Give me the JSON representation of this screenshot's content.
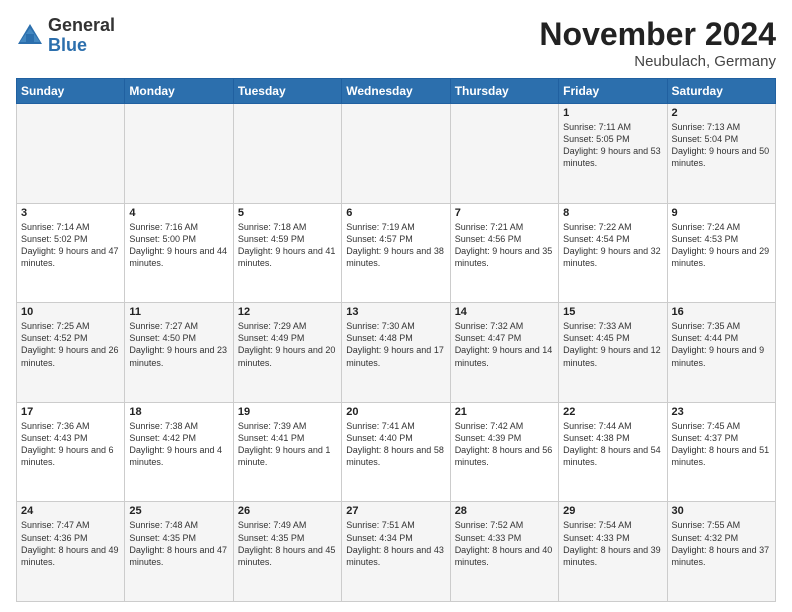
{
  "header": {
    "logo_general": "General",
    "logo_blue": "Blue",
    "month_title": "November 2024",
    "location": "Neubulach, Germany"
  },
  "days_of_week": [
    "Sunday",
    "Monday",
    "Tuesday",
    "Wednesday",
    "Thursday",
    "Friday",
    "Saturday"
  ],
  "weeks": [
    [
      {
        "day": "",
        "info": ""
      },
      {
        "day": "",
        "info": ""
      },
      {
        "day": "",
        "info": ""
      },
      {
        "day": "",
        "info": ""
      },
      {
        "day": "",
        "info": ""
      },
      {
        "day": "1",
        "info": "Sunrise: 7:11 AM\nSunset: 5:05 PM\nDaylight: 9 hours and 53 minutes."
      },
      {
        "day": "2",
        "info": "Sunrise: 7:13 AM\nSunset: 5:04 PM\nDaylight: 9 hours and 50 minutes."
      }
    ],
    [
      {
        "day": "3",
        "info": "Sunrise: 7:14 AM\nSunset: 5:02 PM\nDaylight: 9 hours and 47 minutes."
      },
      {
        "day": "4",
        "info": "Sunrise: 7:16 AM\nSunset: 5:00 PM\nDaylight: 9 hours and 44 minutes."
      },
      {
        "day": "5",
        "info": "Sunrise: 7:18 AM\nSunset: 4:59 PM\nDaylight: 9 hours and 41 minutes."
      },
      {
        "day": "6",
        "info": "Sunrise: 7:19 AM\nSunset: 4:57 PM\nDaylight: 9 hours and 38 minutes."
      },
      {
        "day": "7",
        "info": "Sunrise: 7:21 AM\nSunset: 4:56 PM\nDaylight: 9 hours and 35 minutes."
      },
      {
        "day": "8",
        "info": "Sunrise: 7:22 AM\nSunset: 4:54 PM\nDaylight: 9 hours and 32 minutes."
      },
      {
        "day": "9",
        "info": "Sunrise: 7:24 AM\nSunset: 4:53 PM\nDaylight: 9 hours and 29 minutes."
      }
    ],
    [
      {
        "day": "10",
        "info": "Sunrise: 7:25 AM\nSunset: 4:52 PM\nDaylight: 9 hours and 26 minutes."
      },
      {
        "day": "11",
        "info": "Sunrise: 7:27 AM\nSunset: 4:50 PM\nDaylight: 9 hours and 23 minutes."
      },
      {
        "day": "12",
        "info": "Sunrise: 7:29 AM\nSunset: 4:49 PM\nDaylight: 9 hours and 20 minutes."
      },
      {
        "day": "13",
        "info": "Sunrise: 7:30 AM\nSunset: 4:48 PM\nDaylight: 9 hours and 17 minutes."
      },
      {
        "day": "14",
        "info": "Sunrise: 7:32 AM\nSunset: 4:47 PM\nDaylight: 9 hours and 14 minutes."
      },
      {
        "day": "15",
        "info": "Sunrise: 7:33 AM\nSunset: 4:45 PM\nDaylight: 9 hours and 12 minutes."
      },
      {
        "day": "16",
        "info": "Sunrise: 7:35 AM\nSunset: 4:44 PM\nDaylight: 9 hours and 9 minutes."
      }
    ],
    [
      {
        "day": "17",
        "info": "Sunrise: 7:36 AM\nSunset: 4:43 PM\nDaylight: 9 hours and 6 minutes."
      },
      {
        "day": "18",
        "info": "Sunrise: 7:38 AM\nSunset: 4:42 PM\nDaylight: 9 hours and 4 minutes."
      },
      {
        "day": "19",
        "info": "Sunrise: 7:39 AM\nSunset: 4:41 PM\nDaylight: 9 hours and 1 minute."
      },
      {
        "day": "20",
        "info": "Sunrise: 7:41 AM\nSunset: 4:40 PM\nDaylight: 8 hours and 58 minutes."
      },
      {
        "day": "21",
        "info": "Sunrise: 7:42 AM\nSunset: 4:39 PM\nDaylight: 8 hours and 56 minutes."
      },
      {
        "day": "22",
        "info": "Sunrise: 7:44 AM\nSunset: 4:38 PM\nDaylight: 8 hours and 54 minutes."
      },
      {
        "day": "23",
        "info": "Sunrise: 7:45 AM\nSunset: 4:37 PM\nDaylight: 8 hours and 51 minutes."
      }
    ],
    [
      {
        "day": "24",
        "info": "Sunrise: 7:47 AM\nSunset: 4:36 PM\nDaylight: 8 hours and 49 minutes."
      },
      {
        "day": "25",
        "info": "Sunrise: 7:48 AM\nSunset: 4:35 PM\nDaylight: 8 hours and 47 minutes."
      },
      {
        "day": "26",
        "info": "Sunrise: 7:49 AM\nSunset: 4:35 PM\nDaylight: 8 hours and 45 minutes."
      },
      {
        "day": "27",
        "info": "Sunrise: 7:51 AM\nSunset: 4:34 PM\nDaylight: 8 hours and 43 minutes."
      },
      {
        "day": "28",
        "info": "Sunrise: 7:52 AM\nSunset: 4:33 PM\nDaylight: 8 hours and 40 minutes."
      },
      {
        "day": "29",
        "info": "Sunrise: 7:54 AM\nSunset: 4:33 PM\nDaylight: 8 hours and 39 minutes."
      },
      {
        "day": "30",
        "info": "Sunrise: 7:55 AM\nSunset: 4:32 PM\nDaylight: 8 hours and 37 minutes."
      }
    ]
  ]
}
